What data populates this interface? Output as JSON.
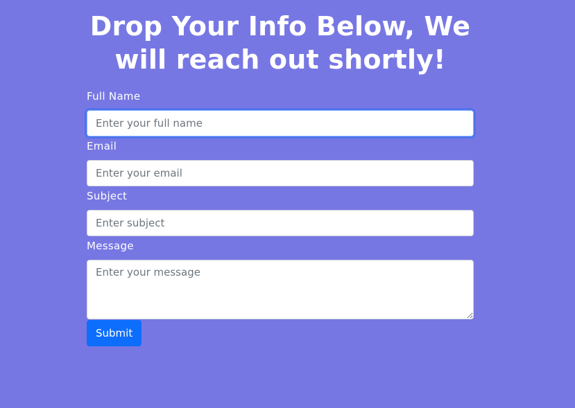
{
  "header": {
    "title_line1": "Drop Your Info Below, We",
    "title_line2": "will reach out shortly!"
  },
  "form": {
    "full_name": {
      "label": "Full Name",
      "placeholder": "Enter your full name",
      "value": ""
    },
    "email": {
      "label": "Email",
      "placeholder": "Enter your email",
      "value": ""
    },
    "subject": {
      "label": "Subject",
      "placeholder": "Enter subject",
      "value": ""
    },
    "message": {
      "label": "Message",
      "placeholder": "Enter your message",
      "value": ""
    },
    "submit_label": "Submit"
  },
  "colors": {
    "background": "#7777e4",
    "button": "#0d6efd",
    "text": "#ffffff"
  }
}
